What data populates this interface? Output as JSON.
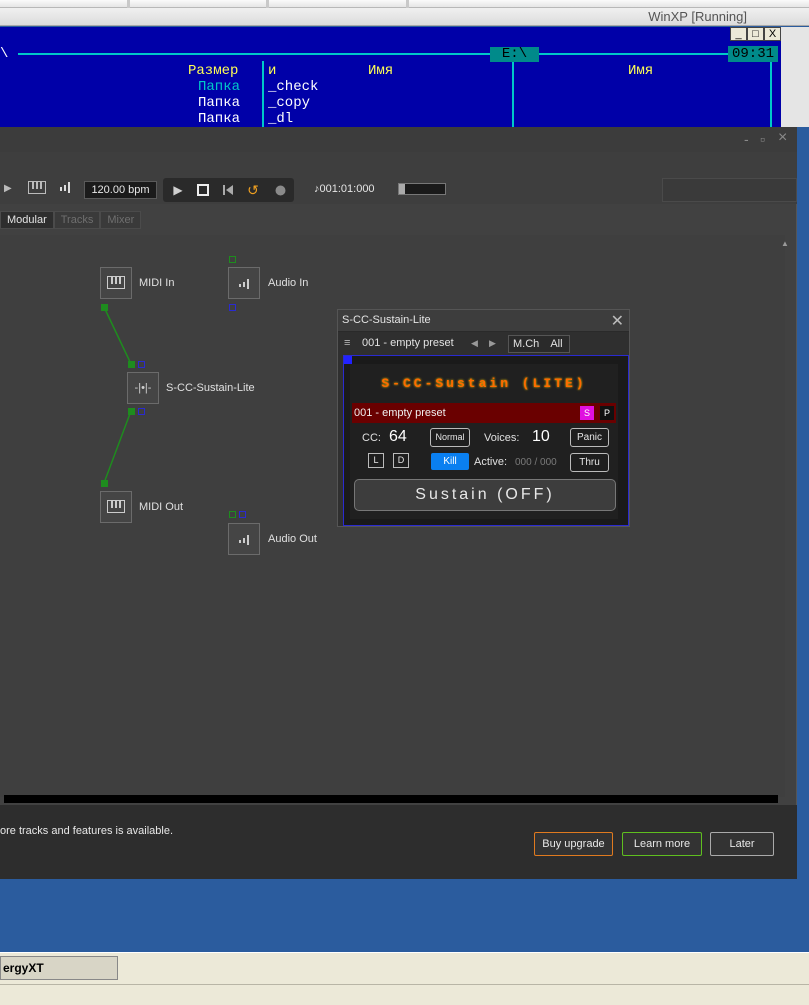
{
  "host": {
    "title": "WinXP [Running]"
  },
  "far": {
    "drive": "E:\\",
    "clock": "09:31",
    "left_header": "Размер",
    "left_items": [
      "Папка",
      "Папка",
      "Папка"
    ],
    "col_header_1": "и",
    "col_header_2": "Имя",
    "col_header_3": "Имя",
    "files": [
      "_check",
      "_copy",
      "_dl"
    ],
    "win_buttons": [
      "_",
      "□",
      "X"
    ]
  },
  "energyxt": {
    "window_controls": [
      "-",
      "▫",
      "×"
    ],
    "toolbar": {
      "bpm": "120.00 bpm",
      "position": "♪001:01:000",
      "transport_icons": [
        "play-icon",
        "stop-icon",
        "rewind-icon",
        "loop-icon",
        "record-icon"
      ],
      "meter_level": 0.12
    },
    "tabs": [
      "Modular",
      "Tracks",
      "Mixer"
    ],
    "nodes": {
      "midi_in": "MIDI In",
      "audio_in": "Audio In",
      "plugin": "S-CC-Sustain-Lite",
      "midi_out": "MIDI Out",
      "audio_out": "Audio Out"
    },
    "plugin_window": {
      "title": "S-CC-Sustain-Lite",
      "preset_selector": "001 - empty preset",
      "midi_channel_label": "M.Ch",
      "midi_channel_value": "All",
      "logo": "S-CC-Sustain (LITE)",
      "preset_name": "001 - empty preset",
      "s_button": "S",
      "p_button": "P",
      "cc_label": "CC:",
      "cc_value": "64",
      "mode_button": "Normal",
      "voices_label": "Voices:",
      "voices_value": "10",
      "panic_button": "Panic",
      "l_button": "L",
      "d_button": "D",
      "kill_button": "Kill",
      "active_label": "Active:",
      "active_value": "000 / 000",
      "thru_button": "Thru",
      "sustain_button": "Sustain (OFF)"
    },
    "notice": {
      "message": "ore tracks and features is available.",
      "buy_button": "Buy upgrade",
      "learn_button": "Learn more",
      "later_button": "Later"
    }
  },
  "taskbar": {
    "item": "ergyXT"
  },
  "colors": {
    "far_blue": "#0000a8",
    "far_cyan": "#00c8c8",
    "kill_blue": "#0a7ff0",
    "preset_red": "#6a0000",
    "logo_orange": "#ff6a00",
    "buy_border": "#e07a1f",
    "learn_border": "#5fbf1f"
  }
}
